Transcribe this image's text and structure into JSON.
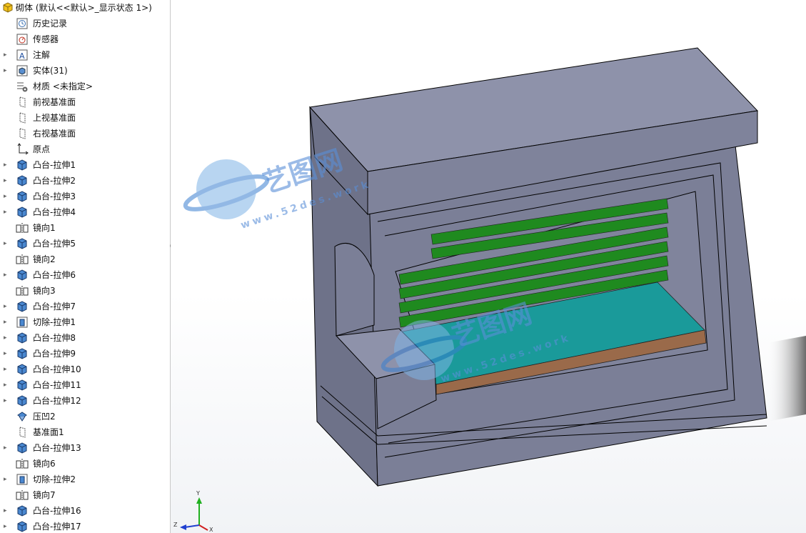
{
  "tree": {
    "root_label": "砌体 (默认<<默认>_显示状态 1>)",
    "items": [
      {
        "label": "历史记录",
        "icon": "history-icon",
        "expandable": false
      },
      {
        "label": "传感器",
        "icon": "sensor-icon",
        "expandable": false
      },
      {
        "label": "注解",
        "icon": "annotation-icon",
        "expandable": true
      },
      {
        "label": "实体(31)",
        "icon": "solid-bodies-icon",
        "expandable": true
      },
      {
        "label": "材质 <未指定>",
        "icon": "material-icon",
        "expandable": false
      },
      {
        "label": "前视基准面",
        "icon": "plane-icon",
        "expandable": false
      },
      {
        "label": "上视基准面",
        "icon": "plane-icon",
        "expandable": false
      },
      {
        "label": "右视基准面",
        "icon": "plane-icon",
        "expandable": false
      },
      {
        "label": "原点",
        "icon": "origin-icon",
        "expandable": false
      },
      {
        "label": "凸台-拉伸1",
        "icon": "boss-extrude-icon",
        "expandable": true
      },
      {
        "label": "凸台-拉伸2",
        "icon": "boss-extrude-icon",
        "expandable": true
      },
      {
        "label": "凸台-拉伸3",
        "icon": "boss-extrude-icon",
        "expandable": true
      },
      {
        "label": "凸台-拉伸4",
        "icon": "boss-extrude-icon",
        "expandable": true
      },
      {
        "label": "镜向1",
        "icon": "mirror-icon",
        "expandable": false
      },
      {
        "label": "凸台-拉伸5",
        "icon": "boss-extrude-icon",
        "expandable": true
      },
      {
        "label": "镜向2",
        "icon": "mirror-icon",
        "expandable": false
      },
      {
        "label": "凸台-拉伸6",
        "icon": "boss-extrude-icon",
        "expandable": true
      },
      {
        "label": "镜向3",
        "icon": "mirror-icon",
        "expandable": false
      },
      {
        "label": "凸台-拉伸7",
        "icon": "boss-extrude-icon",
        "expandable": true
      },
      {
        "label": "切除-拉伸1",
        "icon": "cut-extrude-icon",
        "expandable": true
      },
      {
        "label": "凸台-拉伸8",
        "icon": "boss-extrude-icon",
        "expandable": true
      },
      {
        "label": "凸台-拉伸9",
        "icon": "boss-extrude-icon",
        "expandable": true
      },
      {
        "label": "凸台-拉伸10",
        "icon": "boss-extrude-icon",
        "expandable": true
      },
      {
        "label": "凸台-拉伸11",
        "icon": "boss-extrude-icon",
        "expandable": true
      },
      {
        "label": "凸台-拉伸12",
        "icon": "boss-extrude-icon",
        "expandable": true
      },
      {
        "label": "压凹2",
        "icon": "indent-icon",
        "expandable": false
      },
      {
        "label": "基准面1",
        "icon": "plane-icon",
        "expandable": false
      },
      {
        "label": "凸台-拉伸13",
        "icon": "boss-extrude-icon",
        "expandable": true
      },
      {
        "label": "镜向6",
        "icon": "mirror-icon",
        "expandable": false
      },
      {
        "label": "切除-拉伸2",
        "icon": "cut-extrude-icon",
        "expandable": true
      },
      {
        "label": "镜向7",
        "icon": "mirror-icon",
        "expandable": false
      },
      {
        "label": "凸台-拉伸16",
        "icon": "boss-extrude-icon",
        "expandable": true
      },
      {
        "label": "凸台-拉伸17",
        "icon": "boss-extrude-icon",
        "expandable": true
      }
    ]
  },
  "triad": {
    "x": "X",
    "y": "Y",
    "z": "Z"
  },
  "watermark": {
    "text": "艺图网",
    "url": "www.52des.work"
  },
  "colors": {
    "body": "#7b7f97",
    "body_top": "#8e92aa",
    "body_dark": "#6a6e86",
    "bar_green": "#1f8a1f",
    "bar_rail": "#9aa0ab",
    "glass": "#1a9a9a",
    "wood": "#9a6a4a",
    "axis_x": "#d02020",
    "axis_y": "#20b020",
    "axis_z": "#2040d0"
  }
}
